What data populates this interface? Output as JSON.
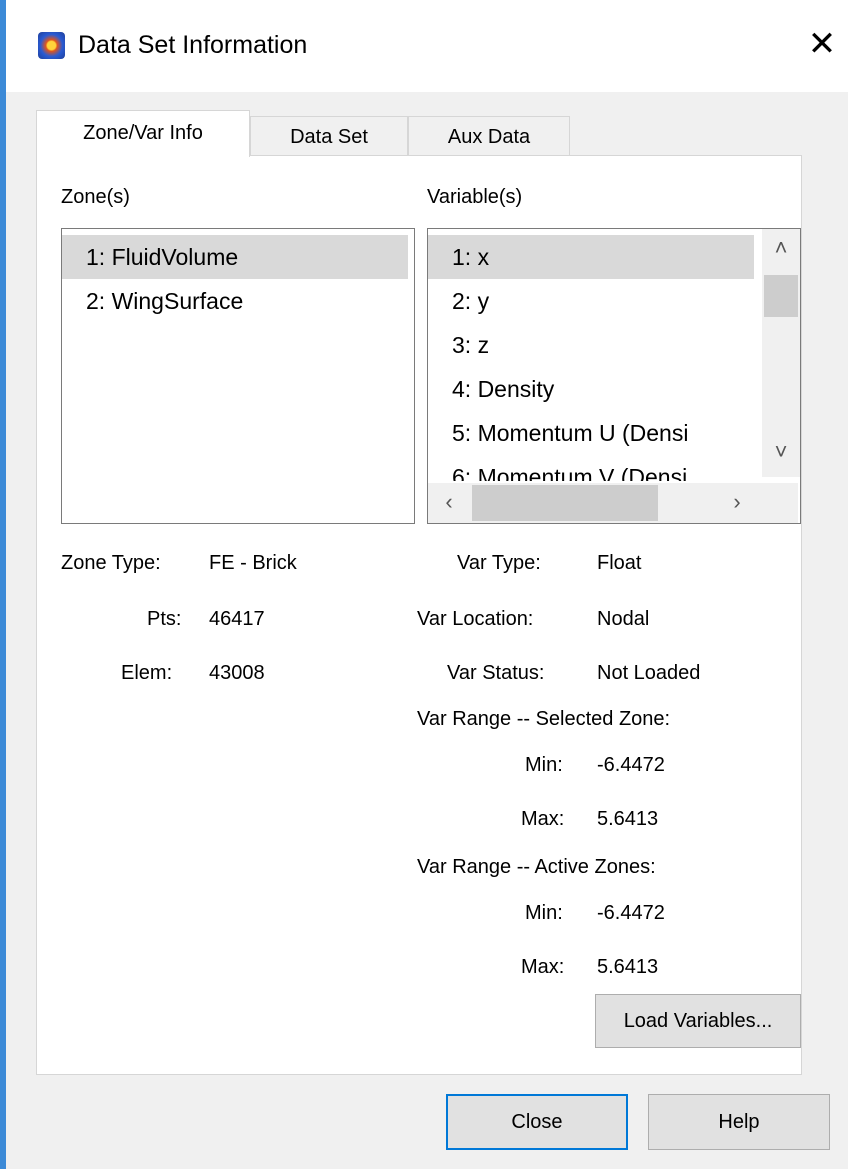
{
  "window": {
    "title": "Data Set Information",
    "close_symbol": "✕"
  },
  "tabs": [
    {
      "label": "Zone/Var Info",
      "active": true
    },
    {
      "label": "Data Set",
      "active": false
    },
    {
      "label": "Aux Data",
      "active": false
    }
  ],
  "zones": {
    "label": "Zone(s)",
    "items": [
      "1: FluidVolume",
      "2: WingSurface"
    ],
    "selected": "1: FluidVolume"
  },
  "variables": {
    "label": "Variable(s)",
    "items": [
      "1: x",
      "2: y",
      "3: z",
      "4: Density",
      "5: Momentum U (Densi",
      "6: Momentum V (Densi"
    ],
    "selected": "1: x"
  },
  "zone_info": {
    "zone_type": {
      "label": "Zone Type:",
      "value": "FE - Brick"
    },
    "pts": {
      "label": "Pts:",
      "value": "46417"
    },
    "elem": {
      "label": "Elem:",
      "value": "43008"
    }
  },
  "var_info": {
    "var_type": {
      "label": "Var Type:",
      "value": "Float"
    },
    "var_location": {
      "label": "Var Location:",
      "value": "Nodal"
    },
    "var_status": {
      "label": "Var Status:",
      "value": "Not Loaded"
    },
    "selected_zone": {
      "heading": "Var Range -- Selected Zone:",
      "min": {
        "label": "Min:",
        "value": "-6.4472"
      },
      "max": {
        "label": "Max:",
        "value": "5.6413"
      }
    },
    "active_zones": {
      "heading": "Var Range -- Active Zones:",
      "min": {
        "label": "Min:",
        "value": "-6.4472"
      },
      "max": {
        "label": "Max:",
        "value": "5.6413"
      }
    }
  },
  "buttons": {
    "load_variables": "Load Variables...",
    "close": "Close",
    "help": "Help"
  },
  "colors": {
    "accent": "#0078d7",
    "selection": "#d9d9d9",
    "window_border": "#3c8ad7"
  },
  "icons": [
    "app-icon",
    "close-icon",
    "chevron-up-icon",
    "chevron-down-icon",
    "chevron-left-icon",
    "chevron-right-icon"
  ]
}
